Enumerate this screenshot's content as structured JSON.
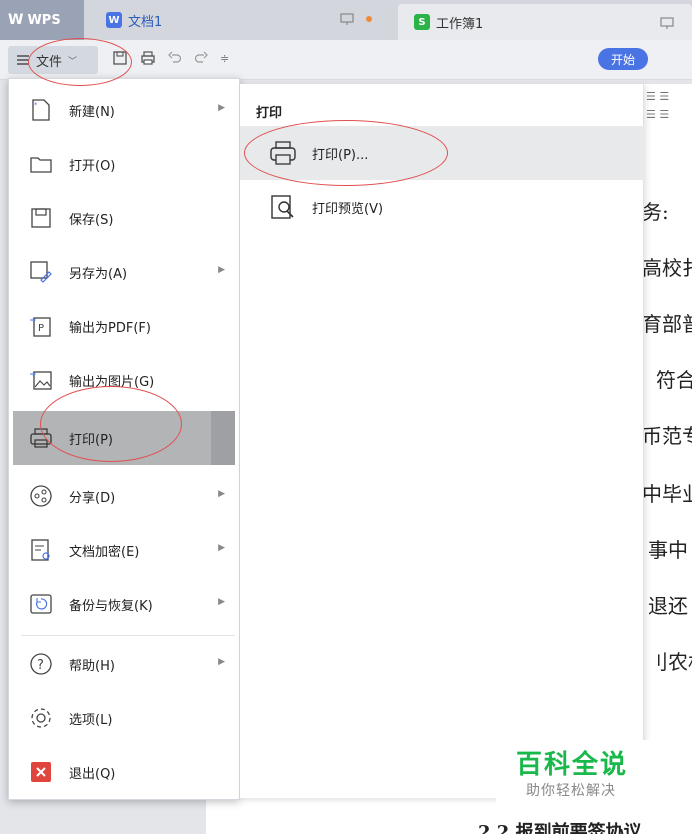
{
  "tabs": {
    "app_name": "WPS",
    "doc_tab": "文档1",
    "doc_badge": "W",
    "sheet_tab": "工作簿1",
    "sheet_badge": "S"
  },
  "toolbar": {
    "file_label": "文件",
    "start_label": "开始"
  },
  "file_menu": {
    "items": [
      {
        "label": "新建(N)"
      },
      {
        "label": "打开(O)"
      },
      {
        "label": "保存(S)"
      },
      {
        "label": "另存为(A)"
      },
      {
        "label": "输出为PDF(F)"
      },
      {
        "label": "输出为图片(G)"
      },
      {
        "label": "打印(P)"
      },
      {
        "label": "分享(D)"
      },
      {
        "label": "文档加密(E)"
      },
      {
        "label": "备份与恢复(K)"
      },
      {
        "label": "帮助(H)"
      },
      {
        "label": "选项(L)"
      },
      {
        "label": "退出(Q)"
      }
    ]
  },
  "print_submenu": {
    "title": "打印",
    "items": [
      {
        "label": "打印(P)..."
      },
      {
        "label": "打印预览(V)"
      }
    ]
  },
  "document": {
    "lines": [
      "务:",
      "高校扌",
      "育部普",
      "符合",
      "币范专",
      "中毕业",
      "事中",
      "退还",
      "刂农材"
    ],
    "bottom_line": "2.2 报到前要签协议"
  },
  "watermark": {
    "title": "百科全说",
    "subtitle": "助你轻松解决"
  },
  "colors": {
    "accent": "#4a74e4",
    "annotation": "#e05050",
    "watermark": "#19b84b",
    "active_item": "#b3b4b6"
  }
}
